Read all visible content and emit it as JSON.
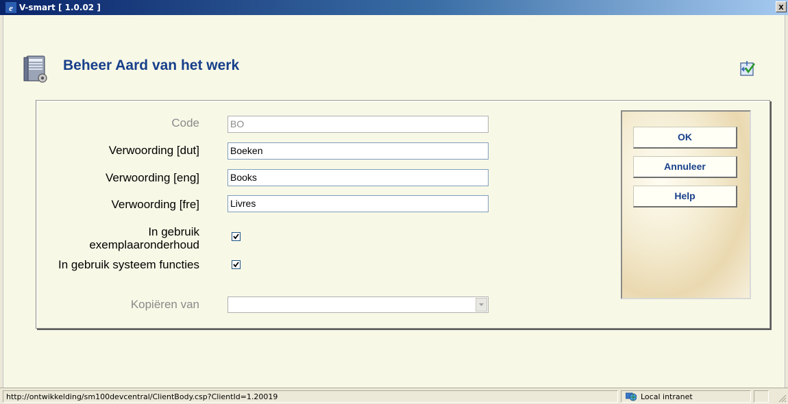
{
  "window": {
    "title": "V-smart [ 1.0.02 ]",
    "close_label": "x"
  },
  "page": {
    "title": "Beheer Aard van het werk"
  },
  "form": {
    "code_label": "Code",
    "code_value": "BO",
    "dut_label": "Verwoording [dut]",
    "dut_value": "Boeken",
    "eng_label": "Verwoording [eng]",
    "eng_value": "Books",
    "fre_label": "Verwoording [fre]",
    "fre_value": "Livres",
    "inuse_items_label_line1": "In gebruik",
    "inuse_items_label_line2": "exemplaaronderhoud",
    "inuse_items_checked": true,
    "inuse_system_label": "In gebruik systeem functies",
    "inuse_system_checked": true,
    "copy_from_label": "Kopiëren van",
    "copy_from_value": ""
  },
  "buttons": {
    "ok": "OK",
    "cancel": "Annuleer",
    "help": "Help"
  },
  "statusbar": {
    "url": "http://ontwikkelding/sm100devcentral/ClientBody.csp?ClientId=1.20019",
    "zone": "Local intranet"
  },
  "icons": {
    "window": "ie-icon",
    "page": "server-settings-icon",
    "help": "help-settings-icon",
    "zone": "globe-icon",
    "check": "checkmark-icon",
    "dropdown": "dropdown-arrow-icon"
  }
}
